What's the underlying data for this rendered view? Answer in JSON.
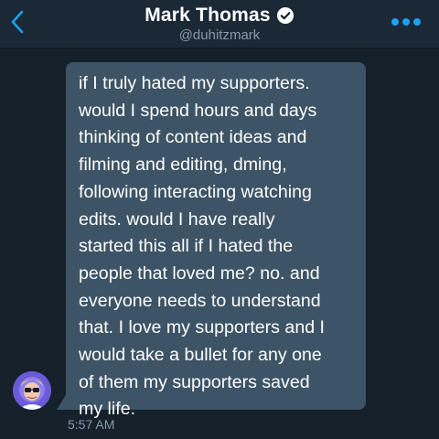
{
  "header": {
    "name": "Mark Thomas",
    "handle": "@duhitzmark",
    "back_icon": "chevron-left-icon",
    "verified_icon": "verified-badge-icon",
    "more_icon": "more-dots-icon",
    "accent_color": "#1da1f2"
  },
  "message": {
    "lines": [
      "if I truly hated my supporters.",
      "would I spend hours and days",
      "thinking of content ideas and",
      "filming and editing, dming,",
      "following interacting watching",
      "edits. would I have really",
      "started this all if I hated the",
      "people that loved me? no. and",
      "everyone needs to understand",
      "that. I love my supporters and I",
      "would take a bullet for any one",
      "of them my supporters saved",
      "my life."
    ],
    "timestamp": "5:57 AM",
    "bubble_color": "#3d5466"
  }
}
